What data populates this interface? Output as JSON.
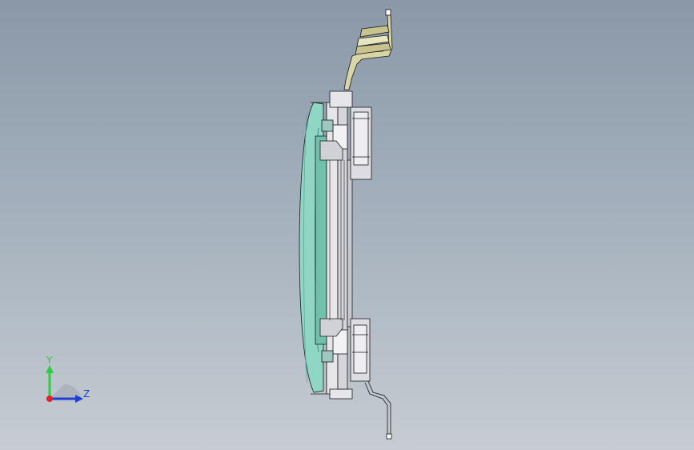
{
  "viewport": {
    "background_top": "#8a98a8",
    "background_bottom": "#c6ccd2"
  },
  "model": {
    "description_icon": "side-view-assembly",
    "line_color": "#1a1a1a",
    "glass_color": "#8fd6c4",
    "frame_color": "#e6e6ea",
    "cable_color": "#d8d6a6"
  },
  "triad": {
    "y_label": "Y",
    "z_label": "Z",
    "y_color": "#2ecc40",
    "z_color": "#1f3fd1",
    "x_color": "#e0202a"
  }
}
